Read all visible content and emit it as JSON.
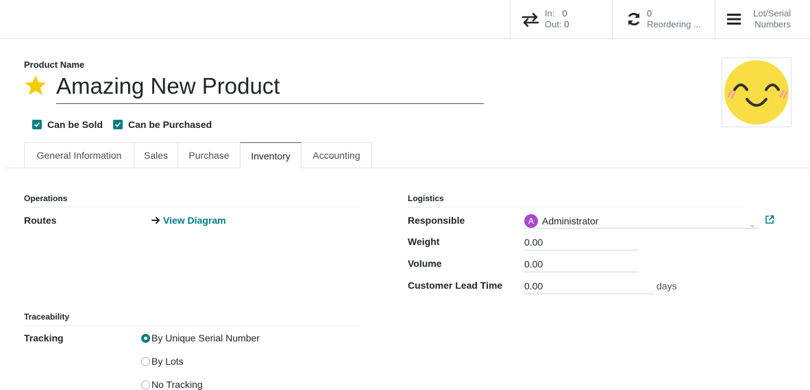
{
  "smart_buttons": {
    "moves": {
      "in_label": "In:",
      "in_value": "0",
      "out_label": "Out:",
      "out_value": "0"
    },
    "reordering": {
      "value": "0",
      "label": "Reordering ..."
    },
    "lots": {
      "label_line1": "Lot/Serial",
      "label_line2": "Numbers"
    }
  },
  "product": {
    "name_label": "Product Name",
    "name": "Amazing New Product",
    "can_be_sold_label": "Can be Sold",
    "can_be_purchased_label": "Can be Purchased"
  },
  "tabs": [
    {
      "label": "General Information",
      "active": false
    },
    {
      "label": "Sales",
      "active": false
    },
    {
      "label": "Purchase",
      "active": false
    },
    {
      "label": "Inventory",
      "active": true
    },
    {
      "label": "Accounting",
      "active": false
    }
  ],
  "operations": {
    "title": "Operations",
    "routes_label": "Routes",
    "view_diagram_label": "View Diagram"
  },
  "traceability": {
    "title": "Traceability",
    "tracking_label": "Tracking",
    "options": [
      {
        "label": "By Unique Serial Number",
        "selected": true
      },
      {
        "label": "By Lots",
        "selected": false
      },
      {
        "label": "No Tracking",
        "selected": false
      }
    ]
  },
  "logistics": {
    "title": "Logistics",
    "responsible_label": "Responsible",
    "responsible_initial": "A",
    "responsible_value": "Administrator",
    "weight_label": "Weight",
    "weight_value": "0.00",
    "volume_label": "Volume",
    "volume_value": "0.00",
    "lead_time_label": "Customer Lead Time",
    "lead_time_value": "0.00",
    "lead_time_unit": "days"
  },
  "colors": {
    "primary": "#714b67",
    "accent": "#017e84",
    "star": "#f3cc00"
  }
}
